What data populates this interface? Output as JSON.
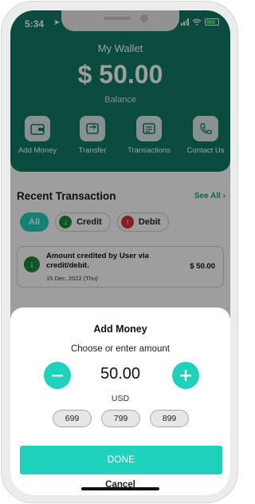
{
  "status_bar": {
    "time": "5:34"
  },
  "wallet": {
    "title": "My Wallet",
    "amount": "$ 50.00",
    "balance_label": "Balance",
    "actions": [
      {
        "label": "Add Money",
        "icon": "wallet-icon"
      },
      {
        "label": "Transfer",
        "icon": "transfer-icon"
      },
      {
        "label": "Transactions",
        "icon": "transactions-icon"
      },
      {
        "label": "Contact Us",
        "icon": "phone-icon"
      }
    ]
  },
  "recent": {
    "title": "Recent Transaction",
    "see_all": "See All",
    "filters": [
      {
        "label": "All",
        "active": true
      },
      {
        "label": "Credit",
        "icon": "arrow-down-icon",
        "color": "#1e8a3c"
      },
      {
        "label": "Debit",
        "icon": "arrow-up-icon",
        "color": "#d9303f"
      }
    ],
    "transactions": [
      {
        "description": "Amount credited by User via credit/debit.",
        "date": "15 Dec, 2022 (Thu)",
        "amount": "$ 50.00",
        "type": "credit"
      }
    ]
  },
  "add_money_sheet": {
    "title": "Add Money",
    "subtitle": "Choose or enter amount",
    "amount": "50.00",
    "currency": "USD",
    "presets": [
      "699",
      "799",
      "899"
    ],
    "done_label": "DONE",
    "cancel_label": "Cancel"
  },
  "colors": {
    "header_green": "#0f7a63",
    "accent_teal": "#1fd0bb",
    "credit_green": "#1e8a3c",
    "debit_red": "#d9303f"
  }
}
